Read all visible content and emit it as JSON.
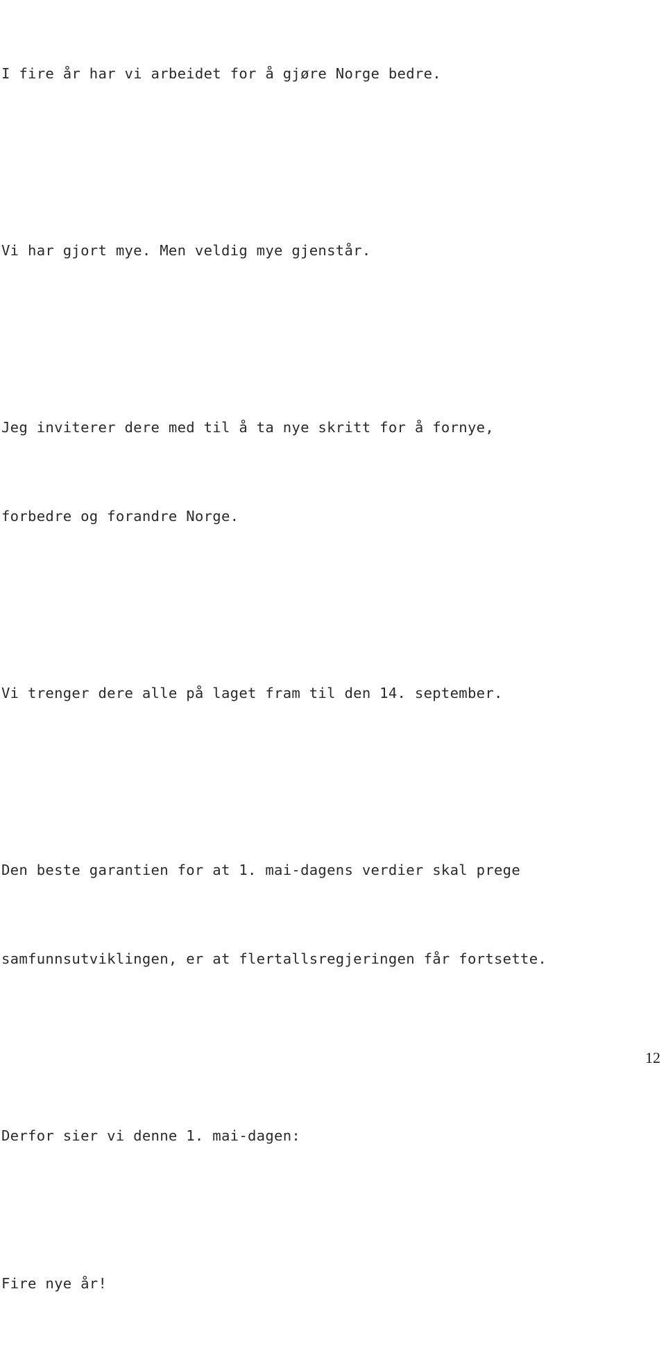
{
  "document": {
    "language": "Norwegian",
    "page_number": "12",
    "text_color": "#2b2b2b",
    "background_color": "#ffffff",
    "paragraphs": [
      {
        "id": "p1",
        "lines": [
          "I fire år har vi arbeidet for å gjøre Norge bedre."
        ]
      },
      {
        "id": "p2",
        "lines": [
          "Vi har gjort mye. Men veldig mye gjenstår."
        ]
      },
      {
        "id": "p3",
        "lines": [
          "Jeg inviterer dere med til å ta nye skritt for å fornye,",
          "forbedre og forandre Norge."
        ]
      },
      {
        "id": "p4",
        "lines": [
          "Vi trenger dere alle på laget fram til den 14. september."
        ]
      },
      {
        "id": "p5",
        "lines": [
          "Den beste garantien for at 1. mai-dagens verdier skal prege",
          "samfunnsutviklingen, er at flertallsregjeringen får fortsette."
        ]
      },
      {
        "id": "p6",
        "lines": [
          "Derfor sier vi denne 1. mai-dagen:"
        ]
      },
      {
        "id": "p7",
        "lines": [
          "Fire nye år!"
        ]
      }
    ]
  }
}
